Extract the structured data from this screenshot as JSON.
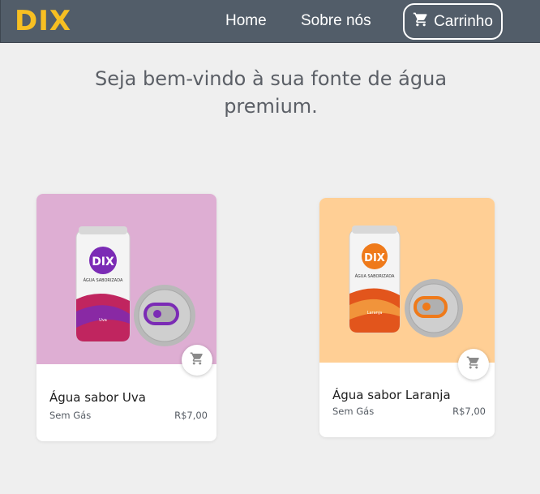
{
  "brand": {
    "logo": "DIX",
    "color": "#f7bf22"
  },
  "nav": {
    "home": "Home",
    "about": "Sobre nós",
    "cart": "Carrinho",
    "cart_icon": "cart-icon"
  },
  "hero": {
    "line1": "Seja bem-vindo à sua fonte de água",
    "line2": "premium."
  },
  "products": [
    {
      "name": "Água sabor Uva",
      "subtitle": "Sem Gás",
      "price": "R$7,00",
      "bg_color": "#deaed3",
      "accent_color": "#7b2bb5",
      "can_logo": "DIX",
      "can_text": "ÁGUA SABORIZADA",
      "can_flavor": "Uva"
    },
    {
      "name": "Água sabor Laranja",
      "subtitle": "Sem Gás",
      "price": "R$7,00",
      "bg_color": "#ffcf95",
      "accent_color": "#ef7a1a",
      "can_logo": "DIX",
      "can_text": "ÁGUA SABORIZADA",
      "can_flavor": "Laranja"
    }
  ]
}
